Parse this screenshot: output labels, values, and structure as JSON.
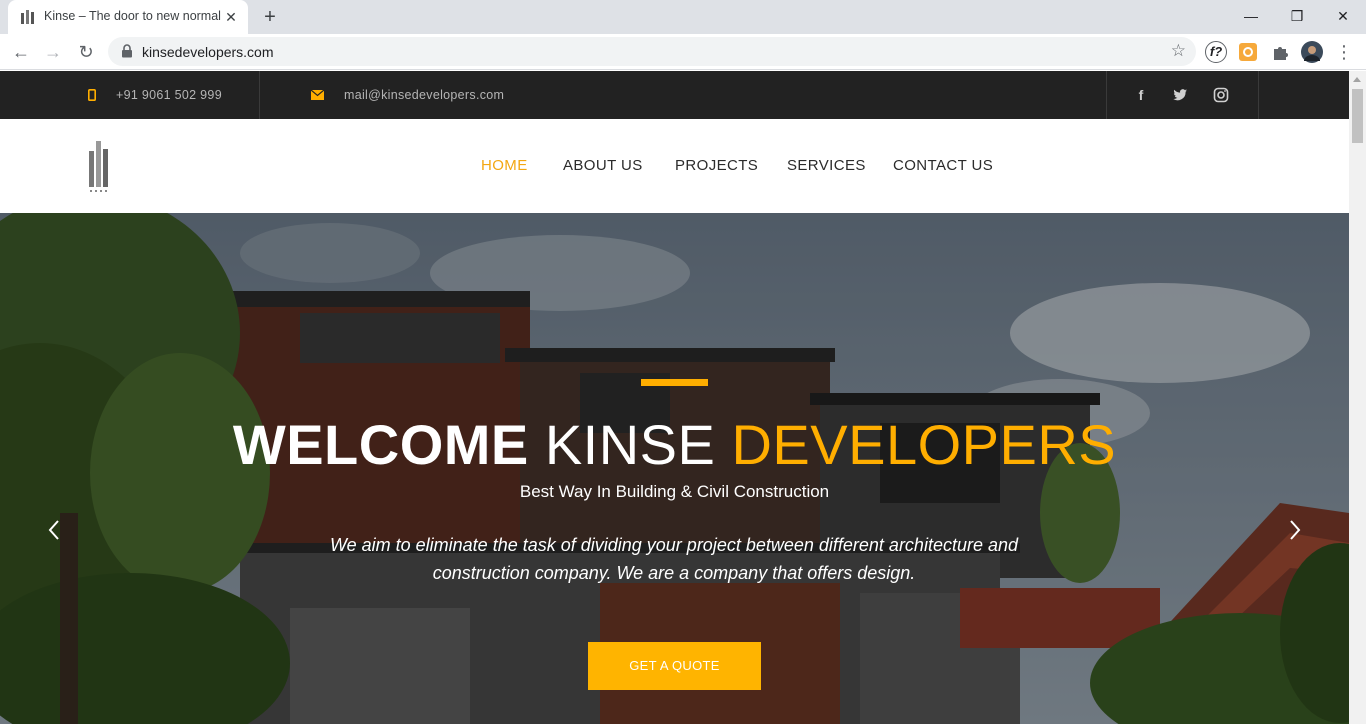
{
  "browser": {
    "tab_title": "Kinse – The door to new normal",
    "tab_close": "✕",
    "new_tab": "+",
    "url": "kinsedevelopers.com",
    "window_controls": {
      "minimize": "—",
      "restore": "❒",
      "close": "✕"
    },
    "nav": {
      "back": "←",
      "forward": "→",
      "reload": "↻"
    },
    "extension_label": "f?"
  },
  "topbar": {
    "phone": "+91 9061 502 999",
    "email": "mail@kinsedevelopers.com",
    "social": {
      "facebook": "f",
      "twitter": "t",
      "instagram": "◎"
    }
  },
  "nav": {
    "items": [
      {
        "label": "HOME",
        "active": true
      },
      {
        "label": "ABOUT US",
        "active": false
      },
      {
        "label": "PROJECTS",
        "active": false
      },
      {
        "label": "SERVICES",
        "active": false
      },
      {
        "label": "CONTACT US",
        "active": false
      }
    ]
  },
  "hero": {
    "headline_part1": "WELCOME",
    "headline_part2": "KINSE",
    "headline_part3": "DEVELOPERS",
    "subheading": "Best Way In Building & Civil Construction",
    "description": "We aim to eliminate the task of dividing your project between different architecture and construction company. We are a company that offers design.",
    "cta_label": "GET A QUOTE"
  },
  "colors": {
    "accent": "#ffae00",
    "nav_active": "#f3a712",
    "topbar_bg": "#222222"
  }
}
